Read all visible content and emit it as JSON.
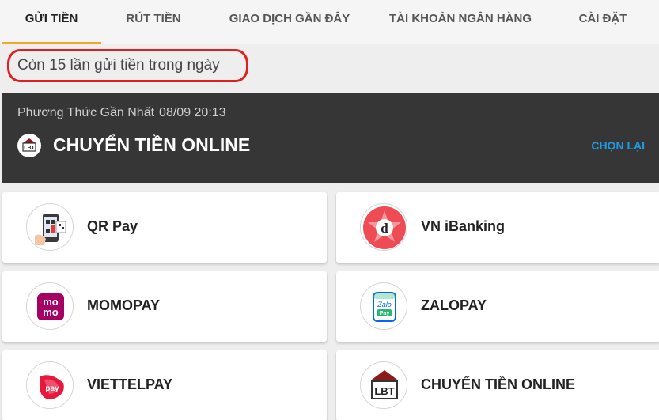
{
  "tabs": [
    {
      "label": "GỬI TIỀN",
      "active": true
    },
    {
      "label": "RÚT TIỀN",
      "active": false
    },
    {
      "label": "GIAO DỊCH GẦN ĐÂY",
      "active": false
    },
    {
      "label": "TÀI KHOẢN NGÂN HÀNG",
      "active": false
    },
    {
      "label": "CÀI ĐẶT",
      "active": false
    }
  ],
  "notice": "Còn 15 lần gửi tiền trong ngày",
  "recent": {
    "heading": "Phương Thức Gần Nhất",
    "timestamp": "08/09 20:13",
    "method": "CHUYỂN TIỀN ONLINE",
    "reselect": "CHỌN LẠI",
    "logo_text": "LBT"
  },
  "methods": [
    {
      "label": "QR Pay",
      "icon": "qr-pay-icon"
    },
    {
      "label": "VN iBanking",
      "icon": "vn-ibanking-icon"
    },
    {
      "label": "MOMOPAY",
      "icon": "momo-icon",
      "logo_text": [
        "mo",
        "mo"
      ]
    },
    {
      "label": "ZALOPAY",
      "icon": "zalopay-icon",
      "logo_text": [
        "Zalo",
        "Pay"
      ]
    },
    {
      "label": "VIETTELPAY",
      "icon": "viettelpay-icon",
      "logo_text": "pay"
    },
    {
      "label": "CHUYỂN TIỀN ONLINE",
      "icon": "lbt-bank-icon",
      "logo_text": "LBT"
    }
  ],
  "colors": {
    "accent": "#f5a623",
    "notice_border": "#e0201e",
    "banner_bg": "#363636",
    "link": "#1e9ce8",
    "momo": "#a50064",
    "zalo": "#0068ff",
    "viettel": "#e8173c"
  }
}
